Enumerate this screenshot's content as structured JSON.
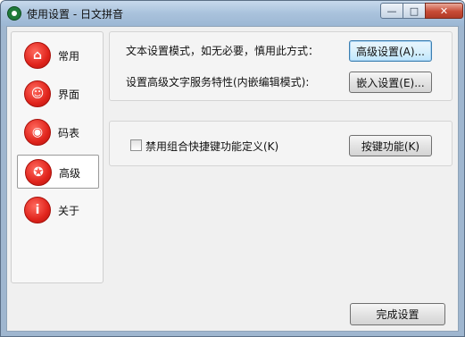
{
  "window": {
    "title": "使用设置 - 日文拼音",
    "controls": {
      "minimize": "—",
      "maximize": "□",
      "close": "✕"
    }
  },
  "sidebar": {
    "items": [
      {
        "label": "常用",
        "icon": "home-icon",
        "glyph": "⌂",
        "active": false
      },
      {
        "label": "界面",
        "icon": "appearance-icon",
        "glyph": "☺",
        "active": false
      },
      {
        "label": "码表",
        "icon": "code-table-icon",
        "glyph": "◉",
        "active": false
      },
      {
        "label": "高级",
        "icon": "advanced-icon",
        "glyph": "✪",
        "active": true
      },
      {
        "label": "关于",
        "icon": "info-icon",
        "glyph": "i",
        "active": false
      }
    ]
  },
  "advanced": {
    "text_settings_label": "文本设置模式，如无必要，慎用此方式：",
    "text_settings_button": "高级设置(A)...",
    "service_label": "设置高级文字服务特性(内嵌编辑模式):",
    "service_button": "嵌入设置(E)...",
    "hotkey_checkbox_label": "禁用组合快捷键功能定义(K)",
    "hotkey_checkbox_checked": false,
    "hotkey_button": "按键功能(K)"
  },
  "footer": {
    "finish_button": "完成设置"
  },
  "colors": {
    "icon_red": "#e0241c",
    "focus_blue": "#3c7fb1"
  }
}
